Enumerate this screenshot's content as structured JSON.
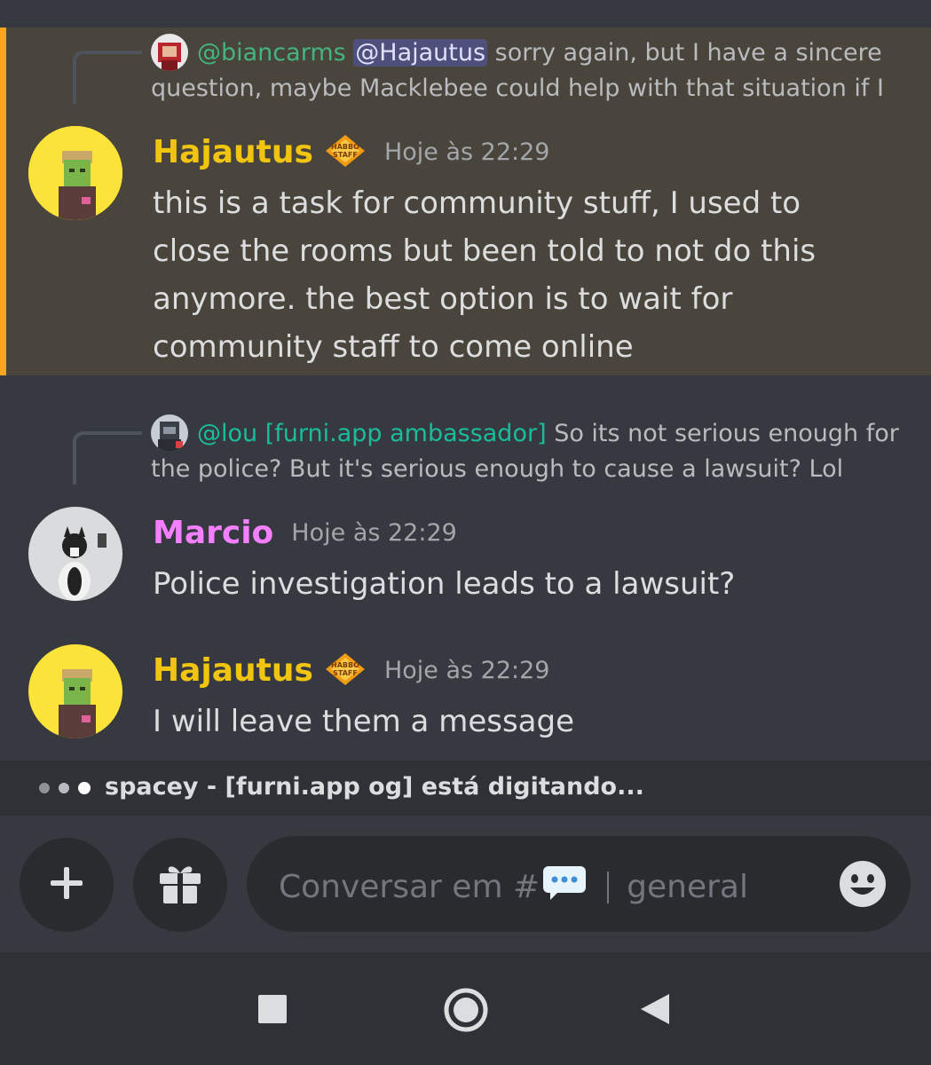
{
  "messages": [
    {
      "reply": {
        "author": "@biancarms",
        "mention": "@Hajautus",
        "text_line1": " sorry again, but I have a sincere",
        "text_line2": "question, maybe Macklebee could help with that situation if I"
      },
      "author": "Hajautus",
      "badge": "HABBO STAFF",
      "time": "Hoje às 22:29",
      "lines": [
        "this is a task for community stuff, I used to",
        "close the rooms but been told to not do this",
        "anymore. the best option is to wait for",
        "community staff to come online"
      ],
      "author_color": "#f1c40f",
      "highlight_color": "#faa81a"
    },
    {
      "reply": {
        "author": "@lou [furni.app ambassador]",
        "text_line1": " So its not serious enough for",
        "text_line2": "the police? But it's serious enough to cause a lawsuit? Lol"
      },
      "author": "Marcio",
      "time": "Hoje às 22:29",
      "lines": [
        "Police investigation leads to a lawsuit?"
      ],
      "author_color": "#f47fff"
    },
    {
      "author": "Hajautus",
      "badge": "HABBO STAFF",
      "time": "Hoje às 22:29",
      "lines": [
        "I will leave them a message"
      ],
      "author_color": "#f1c40f"
    }
  ],
  "typing": {
    "text": "spacey - [furni.app og] está digitando..."
  },
  "composer": {
    "placeholder_prefix": "Conversar em #",
    "channel": "general",
    "add_icon": "plus-icon",
    "gift_icon": "gift-icon",
    "emoji_icon": "emoji-icon"
  },
  "nav": {
    "recents": "square-icon",
    "home": "circle-icon",
    "back": "triangle-back-icon"
  }
}
